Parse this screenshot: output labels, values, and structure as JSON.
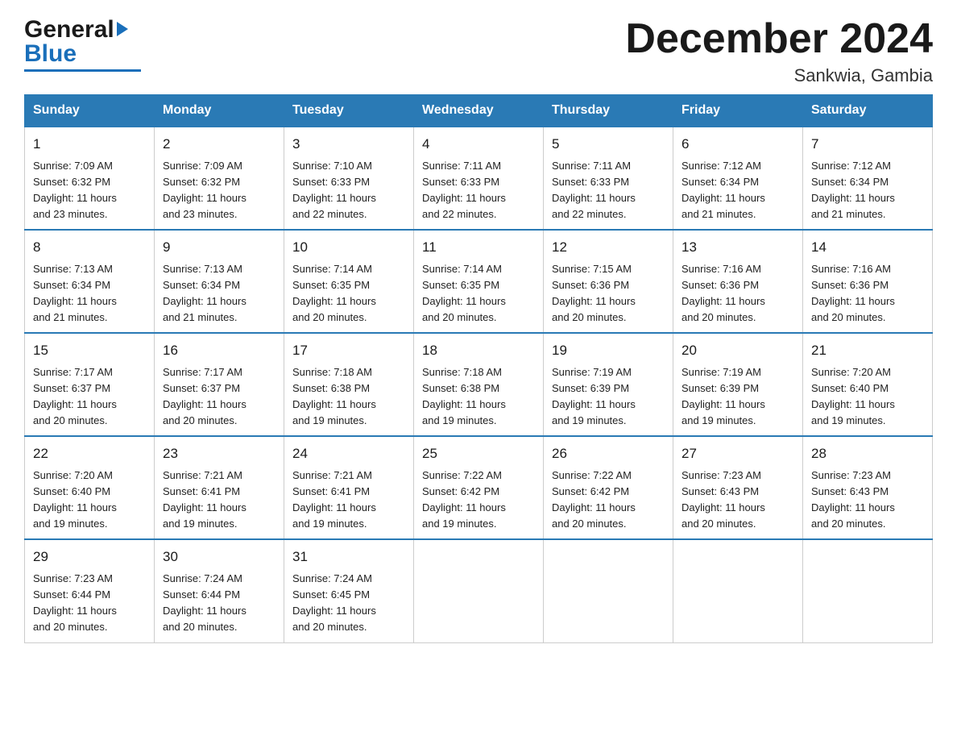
{
  "header": {
    "logo": {
      "general": "General",
      "arrow": "▶",
      "blue": "Blue"
    },
    "title": "December 2024",
    "location": "Sankwia, Gambia"
  },
  "calendar": {
    "days_of_week": [
      "Sunday",
      "Monday",
      "Tuesday",
      "Wednesday",
      "Thursday",
      "Friday",
      "Saturday"
    ],
    "weeks": [
      [
        {
          "day": "1",
          "sunrise": "7:09 AM",
          "sunset": "6:32 PM",
          "daylight": "11 hours and 23 minutes."
        },
        {
          "day": "2",
          "sunrise": "7:09 AM",
          "sunset": "6:32 PM",
          "daylight": "11 hours and 23 minutes."
        },
        {
          "day": "3",
          "sunrise": "7:10 AM",
          "sunset": "6:33 PM",
          "daylight": "11 hours and 22 minutes."
        },
        {
          "day": "4",
          "sunrise": "7:11 AM",
          "sunset": "6:33 PM",
          "daylight": "11 hours and 22 minutes."
        },
        {
          "day": "5",
          "sunrise": "7:11 AM",
          "sunset": "6:33 PM",
          "daylight": "11 hours and 22 minutes."
        },
        {
          "day": "6",
          "sunrise": "7:12 AM",
          "sunset": "6:34 PM",
          "daylight": "11 hours and 21 minutes."
        },
        {
          "day": "7",
          "sunrise": "7:12 AM",
          "sunset": "6:34 PM",
          "daylight": "11 hours and 21 minutes."
        }
      ],
      [
        {
          "day": "8",
          "sunrise": "7:13 AM",
          "sunset": "6:34 PM",
          "daylight": "11 hours and 21 minutes."
        },
        {
          "day": "9",
          "sunrise": "7:13 AM",
          "sunset": "6:34 PM",
          "daylight": "11 hours and 21 minutes."
        },
        {
          "day": "10",
          "sunrise": "7:14 AM",
          "sunset": "6:35 PM",
          "daylight": "11 hours and 20 minutes."
        },
        {
          "day": "11",
          "sunrise": "7:14 AM",
          "sunset": "6:35 PM",
          "daylight": "11 hours and 20 minutes."
        },
        {
          "day": "12",
          "sunrise": "7:15 AM",
          "sunset": "6:36 PM",
          "daylight": "11 hours and 20 minutes."
        },
        {
          "day": "13",
          "sunrise": "7:16 AM",
          "sunset": "6:36 PM",
          "daylight": "11 hours and 20 minutes."
        },
        {
          "day": "14",
          "sunrise": "7:16 AM",
          "sunset": "6:36 PM",
          "daylight": "11 hours and 20 minutes."
        }
      ],
      [
        {
          "day": "15",
          "sunrise": "7:17 AM",
          "sunset": "6:37 PM",
          "daylight": "11 hours and 20 minutes."
        },
        {
          "day": "16",
          "sunrise": "7:17 AM",
          "sunset": "6:37 PM",
          "daylight": "11 hours and 20 minutes."
        },
        {
          "day": "17",
          "sunrise": "7:18 AM",
          "sunset": "6:38 PM",
          "daylight": "11 hours and 19 minutes."
        },
        {
          "day": "18",
          "sunrise": "7:18 AM",
          "sunset": "6:38 PM",
          "daylight": "11 hours and 19 minutes."
        },
        {
          "day": "19",
          "sunrise": "7:19 AM",
          "sunset": "6:39 PM",
          "daylight": "11 hours and 19 minutes."
        },
        {
          "day": "20",
          "sunrise": "7:19 AM",
          "sunset": "6:39 PM",
          "daylight": "11 hours and 19 minutes."
        },
        {
          "day": "21",
          "sunrise": "7:20 AM",
          "sunset": "6:40 PM",
          "daylight": "11 hours and 19 minutes."
        }
      ],
      [
        {
          "day": "22",
          "sunrise": "7:20 AM",
          "sunset": "6:40 PM",
          "daylight": "11 hours and 19 minutes."
        },
        {
          "day": "23",
          "sunrise": "7:21 AM",
          "sunset": "6:41 PM",
          "daylight": "11 hours and 19 minutes."
        },
        {
          "day": "24",
          "sunrise": "7:21 AM",
          "sunset": "6:41 PM",
          "daylight": "11 hours and 19 minutes."
        },
        {
          "day": "25",
          "sunrise": "7:22 AM",
          "sunset": "6:42 PM",
          "daylight": "11 hours and 19 minutes."
        },
        {
          "day": "26",
          "sunrise": "7:22 AM",
          "sunset": "6:42 PM",
          "daylight": "11 hours and 20 minutes."
        },
        {
          "day": "27",
          "sunrise": "7:23 AM",
          "sunset": "6:43 PM",
          "daylight": "11 hours and 20 minutes."
        },
        {
          "day": "28",
          "sunrise": "7:23 AM",
          "sunset": "6:43 PM",
          "daylight": "11 hours and 20 minutes."
        }
      ],
      [
        {
          "day": "29",
          "sunrise": "7:23 AM",
          "sunset": "6:44 PM",
          "daylight": "11 hours and 20 minutes."
        },
        {
          "day": "30",
          "sunrise": "7:24 AM",
          "sunset": "6:44 PM",
          "daylight": "11 hours and 20 minutes."
        },
        {
          "day": "31",
          "sunrise": "7:24 AM",
          "sunset": "6:45 PM",
          "daylight": "11 hours and 20 minutes."
        },
        null,
        null,
        null,
        null
      ]
    ],
    "labels": {
      "sunrise": "Sunrise:",
      "sunset": "Sunset:",
      "daylight": "Daylight:"
    }
  }
}
